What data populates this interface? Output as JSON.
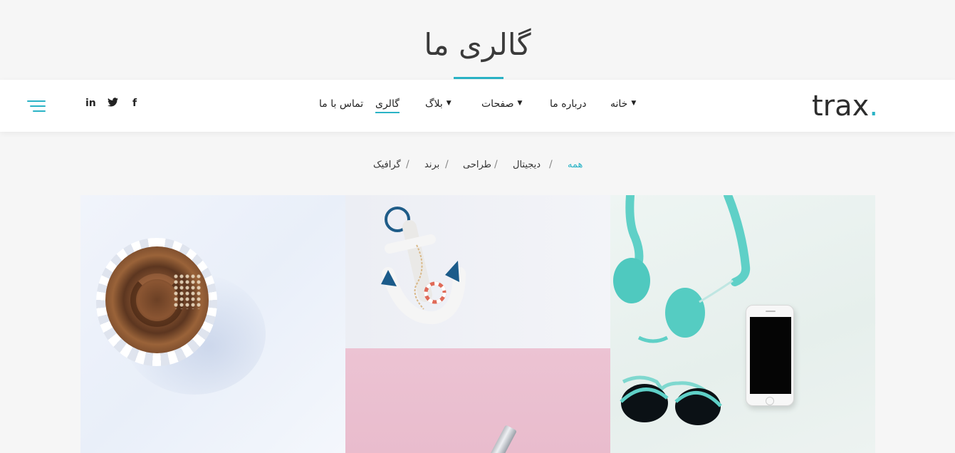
{
  "page": {
    "title": "گالری ما"
  },
  "brand": {
    "name": "trax",
    "dot": ".",
    "accent_color": "#2ab3c6"
  },
  "nav": {
    "items": [
      {
        "label": "خانه",
        "has_dropdown": true
      },
      {
        "label": "درباره ما",
        "has_dropdown": false
      },
      {
        "label": "صفحات",
        "has_dropdown": true
      },
      {
        "label": "بلاگ",
        "has_dropdown": true
      },
      {
        "label": "گالری",
        "has_dropdown": false,
        "active": true
      },
      {
        "label": "تماس با ما",
        "has_dropdown": false
      }
    ],
    "chevron": "▼"
  },
  "social": {
    "facebook": "f",
    "twitter": "twitter-icon",
    "linkedin": "in"
  },
  "menu_toggle": {
    "icon": "hamburger-menu-icon"
  },
  "filters": {
    "items": [
      {
        "label": "همه",
        "active": true
      },
      {
        "label": "دیجیتال"
      },
      {
        "label": "طراحی"
      },
      {
        "label": "برند"
      },
      {
        "label": "گرافیک"
      }
    ],
    "separator": "/"
  },
  "gallery": {
    "items": [
      {
        "subject": "cupcake-image"
      },
      {
        "subject": "anchor-image"
      },
      {
        "subject": "headphones-phone-sunglasses-image"
      },
      {
        "subject": "pink-pen-image"
      }
    ]
  }
}
